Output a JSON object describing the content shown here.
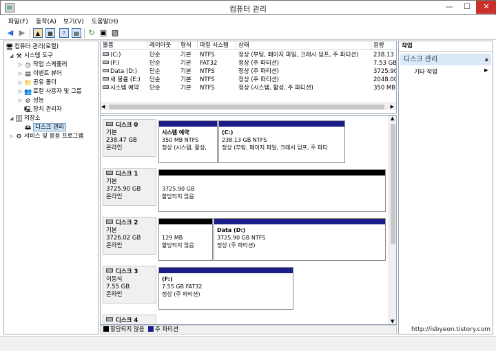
{
  "window": {
    "title": "컴퓨터 관리",
    "minimize": "—",
    "maximize": "☐",
    "close": "✕"
  },
  "menu": [
    "파일(F)",
    "동작(A)",
    "보기(V)",
    "도움말(H)"
  ],
  "tree": {
    "root": "컴퓨터 관리(로컬)",
    "system_tools": "시스템 도구",
    "task_scheduler": "작업 스케줄러",
    "event_viewer": "이벤트 뷰어",
    "shared_folders": "공유 폴더",
    "local_users": "로컬 사용자 및 그룹",
    "performance": "성능",
    "device_manager": "장치 관리자",
    "storage": "저장소",
    "disk_management": "디스크 관리",
    "services_apps": "서비스 및 응용 프로그램"
  },
  "volumes": {
    "headers": [
      "볼륨",
      "레이아웃",
      "형식",
      "파일 시스템",
      "상태",
      "용량"
    ],
    "rows": [
      {
        "volume": "(C:)",
        "layout": "단순",
        "type": "기본",
        "fs": "NTFS",
        "status": "정상 (부팅, 페이지 파일, 크래시 덤프, 주 파티션)",
        "capacity": "238.13 "
      },
      {
        "volume": "(F:)",
        "layout": "단순",
        "type": "기본",
        "fs": "FAT32",
        "status": "정상 (주 파티션)",
        "capacity": "7.53 GB"
      },
      {
        "volume": "Data (D:)",
        "layout": "단순",
        "type": "기본",
        "fs": "NTFS",
        "status": "정상 (주 파티션)",
        "capacity": "3725.90"
      },
      {
        "volume": "새 볼륨 (E:)",
        "layout": "단순",
        "type": "기본",
        "fs": "NTFS",
        "status": "정상 (주 파티션)",
        "capacity": "2048.00"
      },
      {
        "volume": "시스템 예약",
        "layout": "단순",
        "type": "기본",
        "fs": "NTFS",
        "status": "정상 (시스템, 활성, 주 파티션)",
        "capacity": "350 MB"
      }
    ]
  },
  "disks": [
    {
      "name": "디스크 0",
      "type": "기본",
      "size": "238.47 GB",
      "status": "온라인",
      "partitions": [
        {
          "name": "시스템 예약",
          "line1": "350 MB NTFS",
          "line2": "정상 (시스템, 활성,"
        },
        {
          "name": "(C:)",
          "line1": "238.13 GB NTFS",
          "line2": "정상 (부팅, 페이지 파일, 크래시 덤프, 주 파티"
        }
      ]
    },
    {
      "name": "디스크 1",
      "type": "기본",
      "size": "3725.90 GB",
      "status": "온라인",
      "partitions": [
        {
          "name": "",
          "line1": "3725.90 GB",
          "line2": "할당되지 않음"
        }
      ]
    },
    {
      "name": "디스크 2",
      "type": "기본",
      "size": "3726.02 GB",
      "status": "온라인",
      "partitions": [
        {
          "name": "",
          "line1": "129 MB",
          "line2": "할당되지 않음"
        },
        {
          "name": "Data  (D:)",
          "line1": "3725.90 GB NTFS",
          "line2": "정상 (주 파티션)"
        }
      ]
    },
    {
      "name": "디스크 3",
      "type": "이동식",
      "size": "7.55 GB",
      "status": "온라인",
      "partitions": [
        {
          "name": "(F:)",
          "line1": "7.55 GB FAT32",
          "line2": "정상 (주 파티션)"
        }
      ]
    },
    {
      "name": "디스크 4"
    }
  ],
  "legend": {
    "unallocated": "할당되지 않음",
    "primary": "주 파티션",
    "unallocated_color": "#000000",
    "primary_color": "#1c1c8a"
  },
  "actions": {
    "title": "작업",
    "section": "디스크 관리",
    "more": "기타 작업"
  },
  "watermark": "http://isbyeon.tistory.com"
}
